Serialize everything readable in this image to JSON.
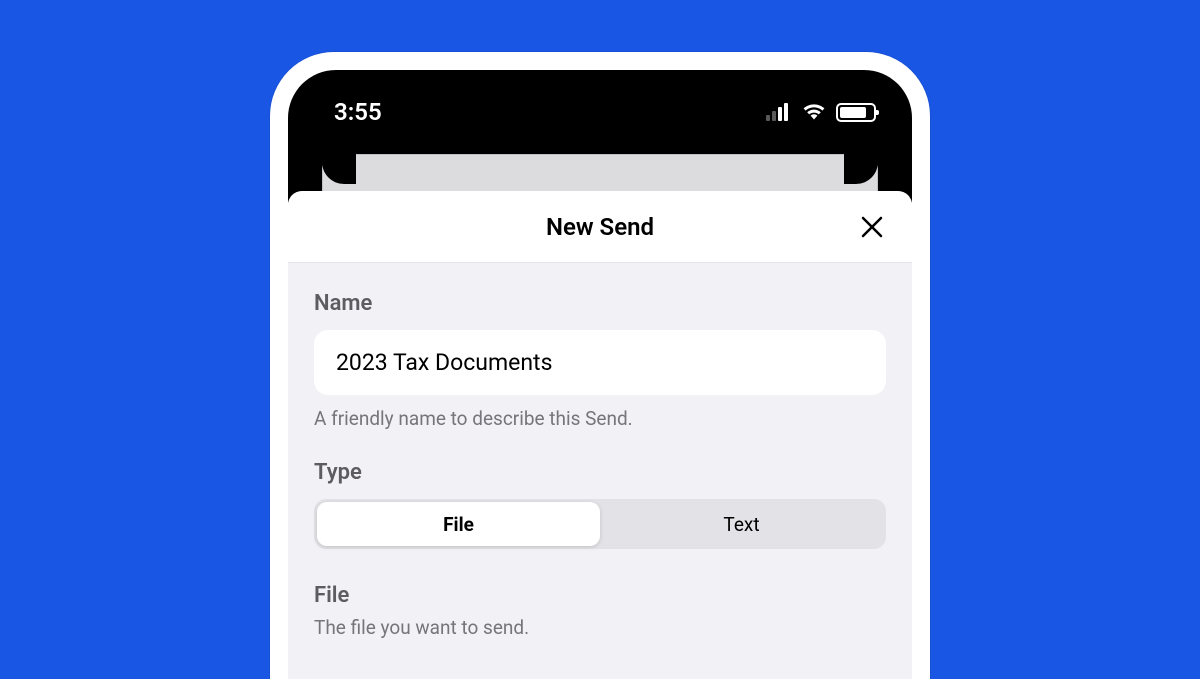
{
  "statusBar": {
    "time": "3:55"
  },
  "modal": {
    "title": "New Send"
  },
  "form": {
    "name": {
      "label": "Name",
      "value": "2023 Tax Documents",
      "helper": "A friendly name to describe this Send."
    },
    "type": {
      "label": "Type",
      "options": {
        "file": "File",
        "text": "Text"
      },
      "selected": "file"
    },
    "file": {
      "label": "File",
      "helper": "The file you want to send."
    }
  }
}
